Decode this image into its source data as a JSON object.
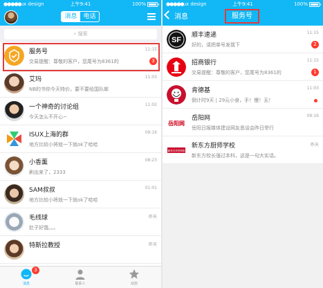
{
  "left": {
    "status": {
      "signal": "●●●●●",
      "carrier": "isux design",
      "time": "上午9:41",
      "battery": "100%"
    },
    "segments": {
      "messages": "消息",
      "calls": "电话"
    },
    "search": {
      "placeholder": "搜索"
    },
    "conversations": [
      {
        "name": "服务号",
        "msg": "交易提醒：尊敬的客户，您尾号为8361的",
        "time": "11:15",
        "badge": "3"
      },
      {
        "name": "艾玛",
        "msg": "NB的书你今天特价，要不要给国队邮",
        "time": "11:03",
        "badge": ""
      },
      {
        "name": "一个神奇的讨论组",
        "msg": "今天怎么不开心~",
        "time": "11:02",
        "badge": ""
      },
      {
        "name": "ISUX上海的群",
        "msg": "地方比较小将就一下就ok了哈哈",
        "time": "09:16",
        "badge": ""
      },
      {
        "name": "小香薰",
        "msg": "刷出来了，2333",
        "time": "08:23",
        "badge": ""
      },
      {
        "name": "SAM叔叔",
        "msg": "地方比较小将就一下就ok了哈哈",
        "time": "01:01",
        "badge": ""
      },
      {
        "name": "毛线球",
        "msg": "肚子好饿。。。",
        "time": "昨天",
        "badge": ""
      },
      {
        "name": "特斯拉教授",
        "msg": "",
        "time": "昨天",
        "badge": ""
      }
    ],
    "tabs": [
      {
        "label": "消息",
        "badge": "3"
      },
      {
        "label": "联系人",
        "badge": ""
      },
      {
        "label": "动态",
        "badge": ""
      }
    ]
  },
  "right": {
    "status": {
      "signal": "●●●●●",
      "carrier": "isux design",
      "time": "上午9:41",
      "battery": "100%"
    },
    "back_label": "消息",
    "title": "服务号",
    "accounts": [
      {
        "name": "顺丰速递",
        "msg": "好的，请把单号发我下",
        "time": "11:15",
        "badge": "2",
        "dot": false
      },
      {
        "name": "招商银行",
        "msg": "交易提醒：尊敬的客户，您尾号为8361的",
        "time": "11:15",
        "badge": "1",
        "dot": false
      },
      {
        "name": "肯德基",
        "msg": "倒计时9天 | 29元小食，手！慢！无！",
        "time": "11:03",
        "badge": "",
        "dot": true
      },
      {
        "name": "岳阳网",
        "msg": "岳阳日报媒体建设网友恳谈会昨日举行",
        "time": "09:16",
        "badge": "",
        "dot": false
      },
      {
        "name": "新东方厨师学校",
        "msg": "新东方校长强过本科，这是一句大实话。",
        "time": "昨天",
        "badge": "",
        "dot": false
      }
    ],
    "logo_texts": {
      "sf": "SF",
      "yueyang": "岳阳网",
      "xdf": "新东方烹饪学校"
    }
  },
  "colors": {
    "accent": "#12b7f5",
    "badge": "#ff3b30",
    "highlight": "#e33b3b"
  }
}
